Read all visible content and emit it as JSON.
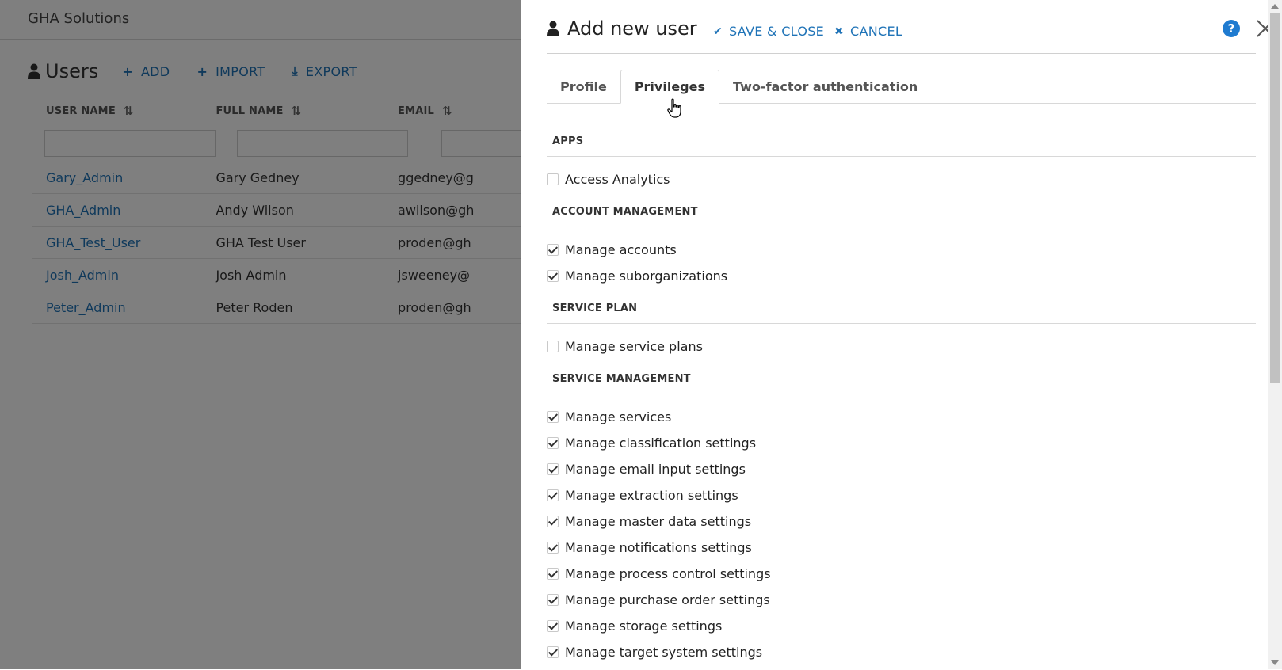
{
  "app": {
    "title": "GHA Solutions",
    "section_title": "Users",
    "toolbar": {
      "add_label": "ADD",
      "import_label": "IMPORT",
      "export_label": "EXPORT"
    },
    "table": {
      "columns": [
        "USER NAME",
        "FULL NAME",
        "EMAIL"
      ],
      "rows": [
        {
          "user_name": "Gary_Admin",
          "full_name": "Gary Gedney",
          "email": "ggedney@g"
        },
        {
          "user_name": "GHA_Admin",
          "full_name": "Andy Wilson",
          "email": "awilson@gh"
        },
        {
          "user_name": "GHA_Test_User",
          "full_name": "GHA Test User",
          "email": "proden@gh"
        },
        {
          "user_name": "Josh_Admin",
          "full_name": "Josh Admin",
          "email": "jsweeney@"
        },
        {
          "user_name": "Peter_Admin",
          "full_name": "Peter Roden",
          "email": "proden@gh"
        }
      ]
    }
  },
  "modal": {
    "title": "Add new user",
    "save_label": "SAVE & CLOSE",
    "cancel_label": "CANCEL",
    "help_label": "?",
    "tabs": [
      {
        "label": "Profile",
        "active": false
      },
      {
        "label": "Privileges",
        "active": true
      },
      {
        "label": "Two-factor authentication",
        "active": false
      }
    ],
    "sections": [
      {
        "title": "APPS",
        "items": [
          {
            "label": "Access Analytics",
            "checked": false
          }
        ]
      },
      {
        "title": "ACCOUNT MANAGEMENT",
        "items": [
          {
            "label": "Manage accounts",
            "checked": true
          },
          {
            "label": "Manage suborganizations",
            "checked": true
          }
        ]
      },
      {
        "title": "SERVICE PLAN",
        "items": [
          {
            "label": "Manage service plans",
            "checked": false
          }
        ]
      },
      {
        "title": "SERVICE MANAGEMENT",
        "items": [
          {
            "label": "Manage services",
            "checked": true
          },
          {
            "label": "Manage classification settings",
            "checked": true
          },
          {
            "label": "Manage email input settings",
            "checked": true
          },
          {
            "label": "Manage extraction settings",
            "checked": true
          },
          {
            "label": "Manage master data settings",
            "checked": true
          },
          {
            "label": "Manage notifications settings",
            "checked": true
          },
          {
            "label": "Manage process control settings",
            "checked": true
          },
          {
            "label": "Manage purchase order settings",
            "checked": true
          },
          {
            "label": "Manage storage settings",
            "checked": true
          },
          {
            "label": "Manage target system settings",
            "checked": true
          }
        ]
      }
    ]
  },
  "colors": {
    "accent": "#1f73b7",
    "help_icon": "#1f7bd0",
    "overlay": "rgba(0,0,0,0.5)"
  }
}
